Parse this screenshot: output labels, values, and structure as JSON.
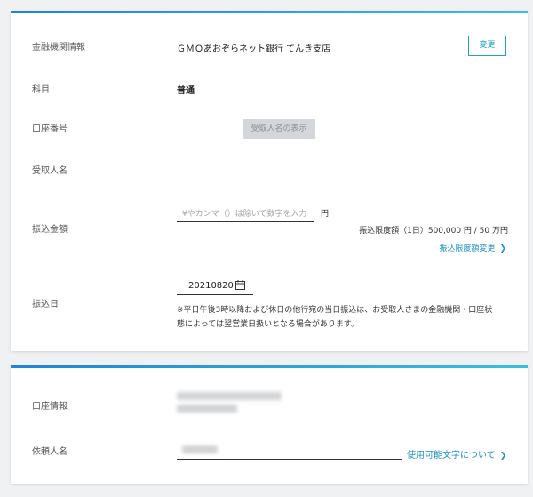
{
  "account_card": {
    "bank_label": "金融機関情報",
    "bank_value": "ＧＭＯあおぞらネット銀行 てんき支店",
    "change_button": "変更",
    "type_label": "科目",
    "type_value": "普通",
    "number_label": "口座番号",
    "number_value": "",
    "show_name_button": "受取人名の表示",
    "recipient_label": "受取人名",
    "amount_label": "振込金額",
    "amount_placeholder": "¥やカンマ（）は除いて数字を入力",
    "amount_unit": "円",
    "limit_text": "振込限度額（1日）500,000 円 / 50 万円",
    "limit_change_link": "振込限度額変更",
    "date_label": "振込日",
    "date_value": "20210820",
    "calendar_icon": "calendar-icon",
    "note_line1": "※平日午後3時以降および休日の他行宛の当日振込は、お受取人さまの金融機関・口座状",
    "note_line2": "態によっては翌営業日扱いとなる場合があります。"
  },
  "sender_card": {
    "account_info_label": "口座情報",
    "sender_name_label": "依頼人名",
    "usable_chars_link": "使用可能文字について"
  },
  "colors": {
    "accent": "#21a2c4",
    "link": "#1f8fc7",
    "gradient_start": "#2185d0",
    "gradient_end": "#3bbde0"
  }
}
